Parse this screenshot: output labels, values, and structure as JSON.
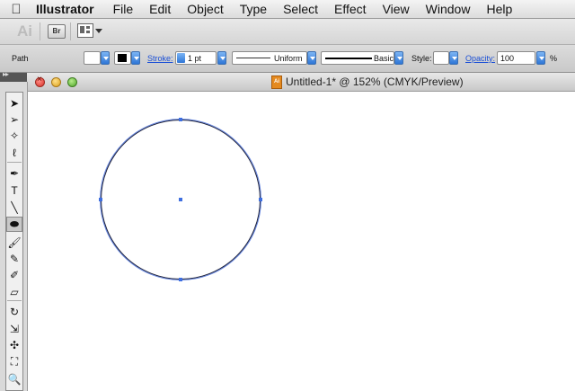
{
  "menubar": {
    "apple_glyph": "",
    "app_name": "Illustrator",
    "items": [
      "File",
      "Edit",
      "Object",
      "Type",
      "Select",
      "Effect",
      "View",
      "Window",
      "Help"
    ]
  },
  "app_bar": {
    "logo": "Ai",
    "bridge_label": "Br"
  },
  "control_bar": {
    "selection_type": "Path",
    "stroke_label": "Stroke:",
    "stroke_weight": "1 pt",
    "profile_label": "Uniform",
    "brush_label": "Basic",
    "style_label": "Style:",
    "opacity_label": "Opacity:",
    "opacity_value": "100",
    "opacity_unit": "%"
  },
  "document": {
    "title": "Untitled-1* @ 152% (CMYK/Preview)",
    "icon_label": "Ai"
  },
  "toolbox": {
    "grip": "▸▸",
    "tools": [
      {
        "name": "selection-tool",
        "glyph": "➤"
      },
      {
        "name": "direct-selection-tool",
        "glyph": "➢"
      },
      {
        "name": "magic-wand-tool",
        "glyph": "✧"
      },
      {
        "name": "lasso-tool",
        "glyph": "ℓ"
      },
      {
        "name": "pen-tool",
        "glyph": "✒"
      },
      {
        "name": "type-tool",
        "glyph": "T"
      },
      {
        "name": "line-segment-tool",
        "glyph": "╲"
      },
      {
        "name": "ellipse-tool",
        "glyph": "⬬"
      },
      {
        "name": "paintbrush-tool",
        "glyph": "🖌"
      },
      {
        "name": "pencil-tool",
        "glyph": "✎"
      },
      {
        "name": "blob-brush-tool",
        "glyph": "✐"
      },
      {
        "name": "eraser-tool",
        "glyph": "▱"
      },
      {
        "name": "rotate-tool",
        "glyph": "↻"
      },
      {
        "name": "scale-tool",
        "glyph": "⇲"
      },
      {
        "name": "puppet-warp-tool",
        "glyph": "✣"
      },
      {
        "name": "free-transform-tool",
        "glyph": "⛶"
      },
      {
        "name": "zoom-tool",
        "glyph": "🔍"
      }
    ]
  },
  "colors": {
    "path_stroke": "#1b1f3a",
    "selection_highlight": "#3f6fe0",
    "link_blue": "#1a4fd6"
  }
}
